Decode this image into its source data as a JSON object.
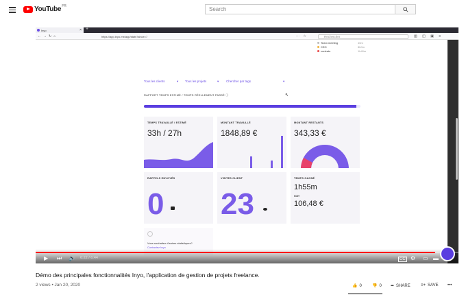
{
  "youtube": {
    "logo_text": "YouTube",
    "country_code": "FR",
    "search_placeholder": "Search"
  },
  "browser": {
    "tab_title": "Inyo",
    "url": "https://app.inyo.me/app/stats?since=7",
    "search_placeholder": "Rechercher"
  },
  "dropdown": {
    "items": [
      {
        "label": "Team meeting",
        "time": "45m",
        "color": "#bbbbbb"
      },
      {
        "label": "CEO",
        "time": "8h0m",
        "color": "#f2b340"
      },
      {
        "label": "contrats",
        "time": "1h40m",
        "color": "#e84d4d"
      }
    ]
  },
  "dashboard": {
    "filters": {
      "clients": "Tous les clients",
      "projects": "Tous les projets",
      "tags": "Chercher par tags"
    },
    "report_label": "RAPPORT TEMPS ESTIMÉ / TEMPS RÉELLEMENT PASSÉ",
    "progress_pct": 0.98,
    "cards": {
      "time_worked": {
        "label": "TEMPS TRAVAILLÉ / ESTIMÉ",
        "value": "33h / 27h"
      },
      "amount_worked": {
        "label": "MONTANT TRAVAILLÉ",
        "value": "1848,89 €"
      },
      "amount_pending": {
        "label": "MONTANT RESTANTS",
        "value": "343,33 €"
      },
      "reminders": {
        "label": "RAPPELS ENVOYÉS",
        "value": "0"
      },
      "client_visits": {
        "label": "VISITES CLIENT",
        "value": "23"
      },
      "time_saved": {
        "label": "TEMPS GAGNÉ",
        "value": "1h55m",
        "sub_label": "SOIT",
        "sub_value": "106,48 €"
      },
      "more_stats": {
        "text": "Vous souhaitez d'autres statistiques?",
        "link": "Contactez Inyo"
      }
    }
  },
  "player": {
    "time": "6:22 / 6:44",
    "progress_pct": 0.945
  },
  "video": {
    "title": "Démo des principales fonctionnalités Inyo, l'application de gestion de projets freelance.",
    "meta": "2 views • Jan 20, 2020",
    "likes": "0",
    "dislikes": "0",
    "share_label": "SHARE",
    "save_label": "SAVE"
  },
  "colors": {
    "brand_purple": "#6b4ee6",
    "youtube_red": "#ff0000",
    "pink": "#e8426a"
  }
}
